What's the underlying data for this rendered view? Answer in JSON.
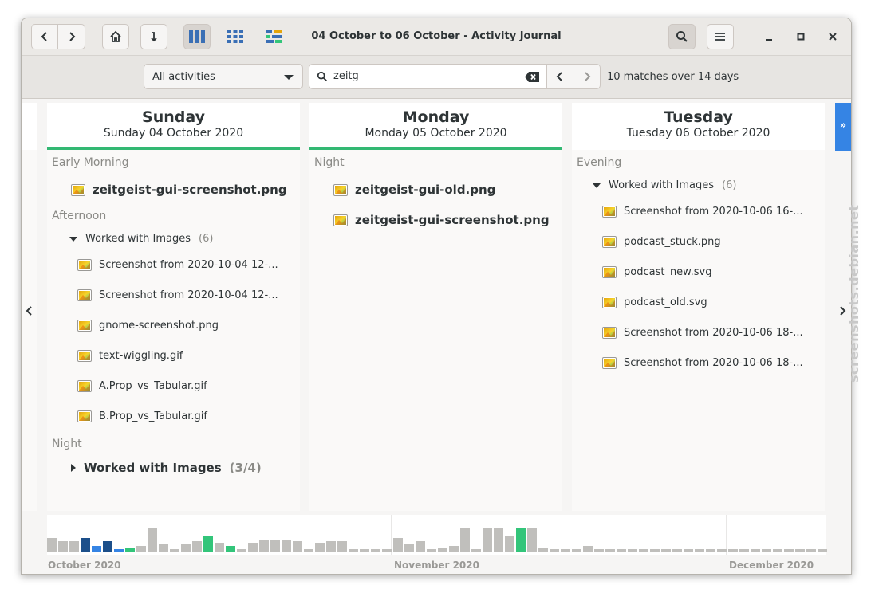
{
  "window": {
    "title": "04 October to 06 October - Activity Journal"
  },
  "toolbar": {
    "filter_selected": "All activities",
    "search_value": "zeitg",
    "matches_text": "10 matches over 14 days"
  },
  "days": [
    {
      "name": "Sunday",
      "date": "Sunday 04 October 2020",
      "early_morning": {
        "label": "Early Morning",
        "items": [
          "zeitgeist-gui-screenshot.png"
        ]
      },
      "afternoon": {
        "label": "Afternoon",
        "group": {
          "label": "Worked with Images",
          "count": "(6)"
        },
        "items": [
          "Screenshot from 2020-10-04 12-...",
          "Screenshot from 2020-10-04 12-...",
          "gnome-screenshot.png",
          "text-wiggling.gif",
          "A.Prop_vs_Tabular.gif",
          "B.Prop_vs_Tabular.gif"
        ]
      },
      "night": {
        "label": "Night",
        "group": {
          "label": "Worked with Images",
          "count": "(3/4)"
        }
      }
    },
    {
      "name": "Monday",
      "date": "Monday 05 October 2020",
      "night": {
        "label": "Night",
        "items": [
          "zeitgeist-gui-old.png",
          "zeitgeist-gui-screenshot.png"
        ]
      }
    },
    {
      "name": "Tuesday",
      "date": "Tuesday 06 October 2020",
      "evening": {
        "label": "Evening",
        "group": {
          "label": "Worked with Images",
          "count": "(6)"
        },
        "items": [
          "Screenshot from 2020-10-06 16-...",
          "podcast_stuck.png",
          "podcast_new.svg",
          "podcast_old.svg",
          "Screenshot from 2020-10-06 18-...",
          "Screenshot from 2020-10-06 18-..."
        ]
      }
    }
  ],
  "histogram": {
    "months": [
      "October 2020",
      "November 2020",
      "December 2020"
    ],
    "values": [
      0.45,
      0.35,
      0.35,
      0.45,
      0.2,
      0.35,
      0.1,
      0.15,
      0.2,
      0.75,
      0.25,
      0.1,
      0.25,
      0.35,
      0.5,
      0.3,
      0.2,
      0.1,
      0.3,
      0.4,
      0.4,
      0.4,
      0.35,
      0.1,
      0.3,
      0.35,
      0.35,
      0.1,
      0.1,
      0.1,
      0.1,
      0.45,
      0.25,
      0.35,
      0.1,
      0.15,
      0.2,
      0.75,
      0.1,
      0.75,
      0.75,
      0.5,
      0.75,
      0.75,
      0.15,
      0.1,
      0.1,
      0.1,
      0.2,
      0.1,
      0.1,
      0.1,
      0.1,
      0.1,
      0.1,
      0.1,
      0.1,
      0.1,
      0.1,
      0.1,
      0.1,
      0.1,
      0.1,
      0.1,
      0.1,
      0.1,
      0.1,
      0.1,
      0.1,
      0.1
    ],
    "highlight_dark": [
      3,
      5
    ],
    "highlight_blue": [
      4,
      6
    ],
    "highlight_green": [
      7,
      14,
      16,
      42
    ],
    "colors": {
      "normal": "#c0bfbc",
      "dark": "#1c4f8a",
      "blue": "#3584e4",
      "green": "#33c57a"
    }
  },
  "watermark": "screenshots.debian.net"
}
